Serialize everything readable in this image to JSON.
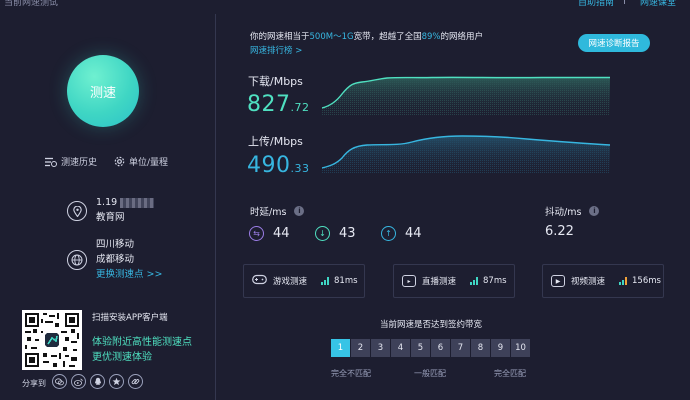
{
  "top": {
    "title_partial": "当前网速测试",
    "link_guide": "自助指南",
    "link_class": "网速课堂"
  },
  "left": {
    "speed_button": "测速",
    "history": "测速历史",
    "unit": "单位/量程",
    "ip": "1.19",
    "network_type": "教育网",
    "isp": "四川移动",
    "location": "成都移动",
    "change_node": "更换测速点 >>",
    "app_title": "扫描安装APP客户端",
    "app_line1": "体验附近高性能测速点",
    "app_line2": "更优测速体验",
    "share_label": "分享到"
  },
  "headline": {
    "prefix": "你的网速相当于",
    "bandwidth": "500M～1G",
    "mid": "宽带，超越了全国",
    "percent": "89%",
    "suffix": "的网络用户",
    "rank_link": "网速排行榜 >",
    "report_button": "网速诊断报告"
  },
  "download": {
    "label": "下载/Mbps",
    "int": "827",
    "dec": ".72"
  },
  "upload": {
    "label": "上传/Mbps",
    "int": "490",
    "dec": ".33"
  },
  "latency": {
    "label": "时延/ms",
    "ping": "44",
    "down": "43",
    "up": "44"
  },
  "jitter": {
    "label": "抖动/ms",
    "value": "6.22"
  },
  "cards": [
    {
      "label": "游戏测速",
      "ms": "81ms"
    },
    {
      "label": "直播测速",
      "ms": "87ms"
    },
    {
      "label": "视频测速",
      "ms": "156ms"
    }
  ],
  "bandwidth_match": {
    "title": "当前网速是否达到签约带宽",
    "cells": [
      "1",
      "2",
      "3",
      "4",
      "5",
      "6",
      "7",
      "8",
      "9",
      "10"
    ],
    "selected_index": 0,
    "cap_left": "完全不匹配",
    "cap_mid": "一般匹配",
    "cap_right": "完全匹配"
  },
  "colors": {
    "download": "#4fe0c0",
    "upload": "#37b6e0",
    "accent": "#2fb9dc",
    "signal_bars": [
      "#3fd6c4",
      "#3fd6c4",
      "#f0a23a"
    ]
  }
}
